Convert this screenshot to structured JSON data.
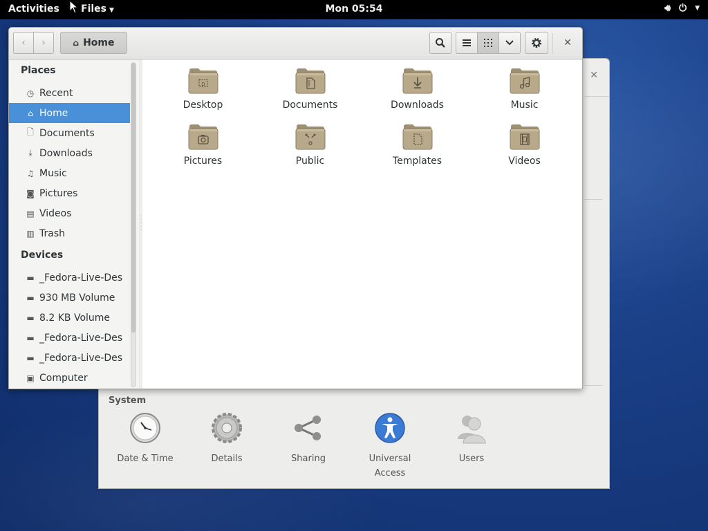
{
  "topbar": {
    "activities": "Activities",
    "app_menu": "Files",
    "clock": "Mon 05:54",
    "icons": [
      "volume-icon",
      "power-icon"
    ]
  },
  "files_window": {
    "path_button": "Home",
    "sidebar": {
      "places_header": "Places",
      "places": [
        {
          "label": "Recent",
          "icon": "clock-icon"
        },
        {
          "label": "Home",
          "icon": "home-icon",
          "active": true
        },
        {
          "label": "Documents",
          "icon": "document-icon"
        },
        {
          "label": "Downloads",
          "icon": "download-icon"
        },
        {
          "label": "Music",
          "icon": "music-icon"
        },
        {
          "label": "Pictures",
          "icon": "camera-icon"
        },
        {
          "label": "Videos",
          "icon": "film-icon"
        },
        {
          "label": "Trash",
          "icon": "trash-icon"
        }
      ],
      "devices_header": "Devices",
      "devices": [
        {
          "label": "_Fedora-Live-Des",
          "icon": "drive-icon"
        },
        {
          "label": "930 MB Volume",
          "icon": "drive-icon"
        },
        {
          "label": "8.2 KB Volume",
          "icon": "drive-icon"
        },
        {
          "label": "_Fedora-Live-Des",
          "icon": "drive-icon"
        },
        {
          "label": "_Fedora-Live-Des",
          "icon": "drive-icon"
        },
        {
          "label": "Computer",
          "icon": "computer-icon"
        }
      ]
    },
    "folders": [
      {
        "label": "Desktop",
        "glyph": "desktop"
      },
      {
        "label": "Documents",
        "glyph": "documents"
      },
      {
        "label": "Downloads",
        "glyph": "downloads"
      },
      {
        "label": "Music",
        "glyph": "music"
      },
      {
        "label": "Pictures",
        "glyph": "pictures"
      },
      {
        "label": "Public",
        "glyph": "public"
      },
      {
        "label": "Templates",
        "glyph": "templates"
      },
      {
        "label": "Videos",
        "glyph": "videos"
      }
    ],
    "colors": {
      "accent": "#4a90d9",
      "folder": "#b7a98a"
    }
  },
  "settings_window": {
    "system_header": "System",
    "items": [
      {
        "label": "Date & Time",
        "icon": "clock-icon"
      },
      {
        "label": "Details",
        "icon": "gear-icon"
      },
      {
        "label": "Sharing",
        "icon": "share-icon"
      },
      {
        "label": "Universal Access",
        "icon": "accessibility-icon"
      },
      {
        "label": "Users",
        "icon": "users-icon"
      }
    ]
  }
}
